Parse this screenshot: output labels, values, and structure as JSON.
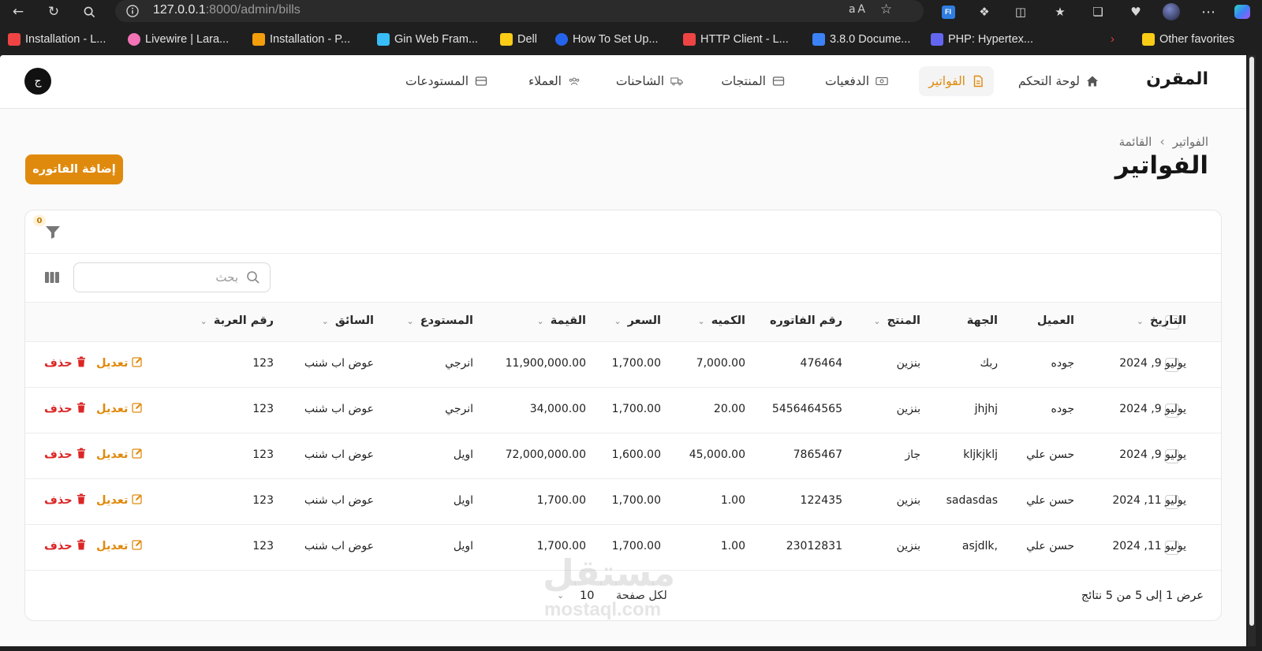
{
  "browser": {
    "url_host": "127.0.0.1",
    "url_path": ":8000/admin/bills",
    "bookmarks": [
      {
        "label": "Installation - L...",
        "color": "#ef4444"
      },
      {
        "label": "Livewire | Lara...",
        "color": "#f472b6"
      },
      {
        "label": "Installation - P...",
        "color": "#f59e0b"
      },
      {
        "label": "Gin Web Fram...",
        "color": "#38bdf8"
      },
      {
        "label": "Dell",
        "color": "#facc15"
      },
      {
        "label": "How To Set Up...",
        "color": "#2563eb"
      },
      {
        "label": "HTTP Client - L...",
        "color": "#ef4444"
      },
      {
        "label": "3.8.0 Docume...",
        "color": "#3b82f6"
      },
      {
        "label": "PHP: Hypertex...",
        "color": "#6366f1"
      }
    ],
    "other_favorites": "Other favorites"
  },
  "app": {
    "brand": "المقرن",
    "avatar": "ج",
    "nav": [
      {
        "label": "لوحة التحكم"
      },
      {
        "label": "الفواتير"
      },
      {
        "label": "الدفعيات"
      },
      {
        "label": "المنتجات"
      },
      {
        "label": "الشاحنات"
      },
      {
        "label": "العملاء"
      },
      {
        "label": "المستودعات"
      }
    ],
    "accent": "#e08a0d"
  },
  "page": {
    "breadcrumb_root": "الفواتير",
    "breadcrumb_current": "القائمة",
    "title": "الفواتير",
    "add_button": "إضافة الفاتوره"
  },
  "table": {
    "filter_count": "0",
    "search_placeholder": "بحث",
    "columns": [
      "التاريخ",
      "العميل",
      "الجهة",
      "المنتج",
      "رقم الفاتوره",
      "الكميه",
      "السعر",
      "القيمة",
      "المستودع",
      "السائق",
      "رقم العربة"
    ],
    "rows": [
      {
        "date": "يوليو 9, 2024",
        "client": "جوده",
        "side": "ربك",
        "product": "بنزين",
        "invoice": "476464",
        "qty": "7,000.00",
        "price": "1,700.00",
        "value": "11,900,000.00",
        "warehouse": "انرجي",
        "driver": "عوض اب شنب",
        "truck": "123"
      },
      {
        "date": "يوليو 9, 2024",
        "client": "جوده",
        "side": "jhjhj",
        "product": "بنزين",
        "invoice": "5456464565",
        "qty": "20.00",
        "price": "1,700.00",
        "value": "34,000.00",
        "warehouse": "انرجي",
        "driver": "عوض اب شنب",
        "truck": "123"
      },
      {
        "date": "يوليو 9, 2024",
        "client": "حسن علي",
        "side": "kljkjklj",
        "product": "جاز",
        "invoice": "7865467",
        "qty": "45,000.00",
        "price": "1,600.00",
        "value": "72,000,000.00",
        "warehouse": "اويل",
        "driver": "عوض اب شنب",
        "truck": "123"
      },
      {
        "date": "يوليو 11, 2024",
        "client": "حسن علي",
        "side": "sadasdas",
        "product": "بنزين",
        "invoice": "122435",
        "qty": "1.00",
        "price": "1,700.00",
        "value": "1,700.00",
        "warehouse": "اويل",
        "driver": "عوض اب شنب",
        "truck": "123"
      },
      {
        "date": "يوليو 11, 2024",
        "client": "حسن علي",
        "side": "asjdlk,",
        "product": "بنزين",
        "invoice": "23012831",
        "qty": "1.00",
        "price": "1,700.00",
        "value": "1,700.00",
        "warehouse": "اويل",
        "driver": "عوض اب شنب",
        "truck": "123"
      }
    ],
    "edit_label": "تعديل",
    "delete_label": "حذف",
    "results_text": "عرض 1 إلى 5 من 5 نتائج",
    "per_page_label": "لكل صفحة",
    "per_page_value": "10"
  },
  "watermark": {
    "ar": "مستقل",
    "en": "mostaql.com"
  }
}
